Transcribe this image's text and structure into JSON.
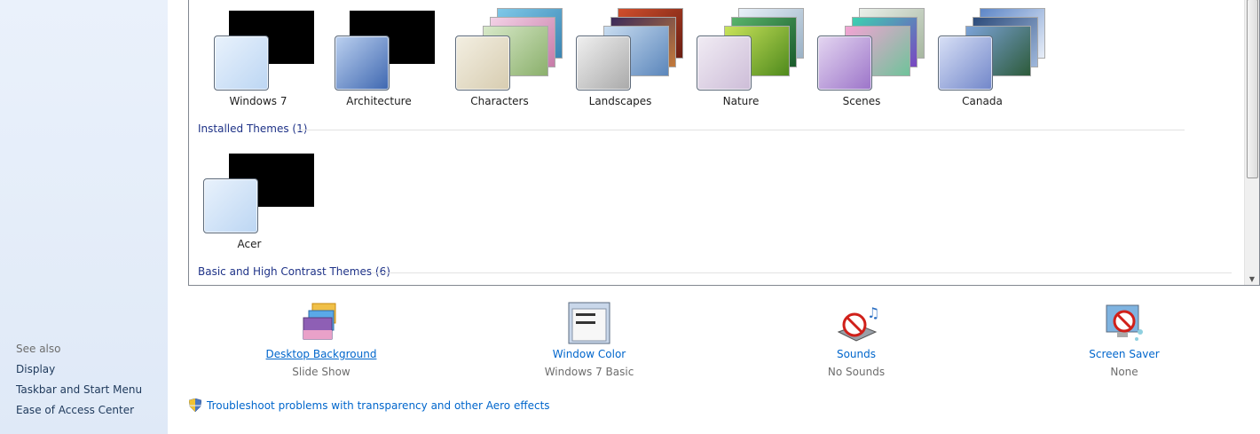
{
  "left_pane": {
    "see_also": "See also",
    "links": [
      "Display",
      "Taskbar and Start Menu",
      "Ease of Access Center"
    ]
  },
  "my_themes_row": [
    {
      "label": "Windows 7",
      "icon": "windows7-theme-icon",
      "style": "blackbg"
    },
    {
      "label": "Architecture",
      "icon": "architecture-theme-icon",
      "style": "blackbg-blue"
    },
    {
      "label": "Characters",
      "icon": "characters-theme-icon",
      "style": "stack"
    },
    {
      "label": "Landscapes",
      "icon": "landscapes-theme-icon",
      "style": "stack"
    },
    {
      "label": "Nature",
      "icon": "nature-theme-icon",
      "style": "stack"
    },
    {
      "label": "Scenes",
      "icon": "scenes-theme-icon",
      "style": "stack"
    },
    {
      "label": "Canada",
      "icon": "canada-theme-icon",
      "style": "stack"
    }
  ],
  "installed_themes": {
    "heading": "Installed Themes (1)",
    "items": [
      {
        "label": "Acer",
        "icon": "acer-theme-icon"
      }
    ]
  },
  "basic_themes": {
    "heading": "Basic and High Contrast Themes (6)"
  },
  "bottom": {
    "desktop_background": {
      "label": "Desktop Background",
      "value": "Slide Show"
    },
    "window_color": {
      "label": "Window Color",
      "value": "Windows 7 Basic"
    },
    "sounds": {
      "label": "Sounds",
      "value": "No Sounds"
    },
    "screen_saver": {
      "label": "Screen Saver",
      "value": "None"
    }
  },
  "troubleshoot_link": "Troubleshoot problems with transparency and other Aero effects",
  "colors": {
    "link": "#0066cc",
    "section_heading": "#1e3287",
    "left_pane_bg": "#e5eef9"
  }
}
